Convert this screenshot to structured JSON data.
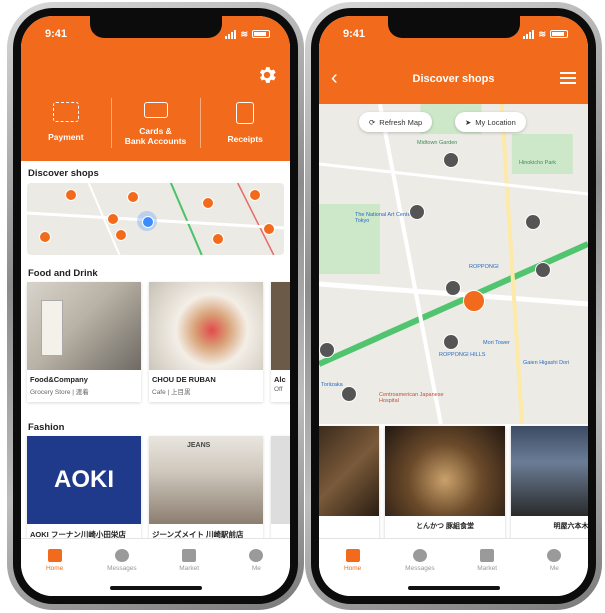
{
  "colors": {
    "brand": "#f26a1b"
  },
  "left_screen": {
    "status_time": "9:41",
    "quick_actions": [
      {
        "label": "Payment",
        "icon": "qr-scan-icon"
      },
      {
        "label": "Cards &\nBank Accounts",
        "icon": "card-icon"
      },
      {
        "label": "Receipts",
        "icon": "receipt-icon"
      }
    ],
    "discover_title": "Discover shops",
    "food_title": "Food and Drink",
    "food_cards": [
      {
        "name": "Food&Company",
        "sub": "Grocery Store | 渡着"
      },
      {
        "name": "CHOU DE RUBAN",
        "sub": "Cafe | 上目黒"
      },
      {
        "name": "Alc",
        "sub": "Off"
      }
    ],
    "fashion_title": "Fashion",
    "fashion_cards": [
      {
        "name": "AOKI フーナン川崎小田栄店",
        "logo": "AOKI"
      },
      {
        "name": "ジーンズメイト 川崎駅前店",
        "logo": "JEANS"
      }
    ],
    "tabs": [
      {
        "label": "Home",
        "icon": "home-icon"
      },
      {
        "label": "Messages",
        "icon": "chat-icon"
      },
      {
        "label": "Market",
        "icon": "bag-icon"
      },
      {
        "label": "Me",
        "icon": "person-icon"
      }
    ]
  },
  "right_screen": {
    "status_time": "9:41",
    "nav_title": "Discover shops",
    "refresh_label": "Refresh Map",
    "location_label": "My Location",
    "map_labels": [
      "Midtown Garden",
      "The National Art Center, Tokyo",
      "ROPPONGI",
      "ROPPONGI HILLS",
      "Mori Tower",
      "Hinokicho Park",
      "Centroamerican Japanese Hospital",
      "Toriizaka",
      "Gaien Higashi Dori"
    ],
    "shops": [
      {
        "name": ""
      },
      {
        "name": "とんかつ 豚組食堂"
      },
      {
        "name": "明屋六本木"
      }
    ],
    "tabs": [
      {
        "label": "Home",
        "icon": "home-icon"
      },
      {
        "label": "Messages",
        "icon": "chat-icon"
      },
      {
        "label": "Market",
        "icon": "bag-icon"
      },
      {
        "label": "Me",
        "icon": "person-icon"
      }
    ]
  }
}
